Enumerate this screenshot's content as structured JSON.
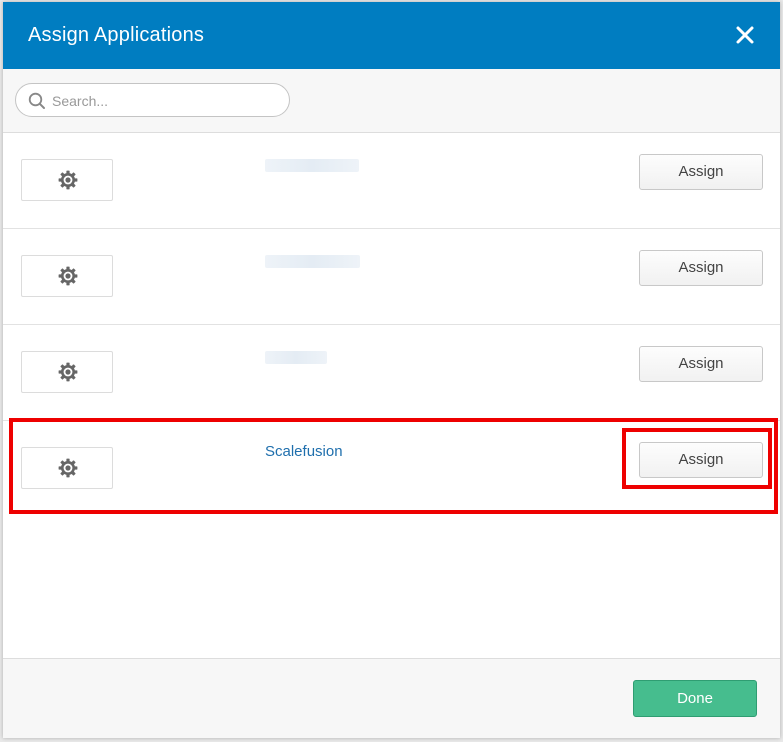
{
  "dialog": {
    "title": "Assign Applications",
    "close_icon": "close-icon"
  },
  "search": {
    "placeholder": "Search...",
    "value": "",
    "icon": "search-icon"
  },
  "apps": [
    {
      "name": "",
      "name_redacted": true,
      "logo_icon": "gear-icon",
      "assign_label": "Assign"
    },
    {
      "name": "",
      "name_redacted": true,
      "logo_icon": "gear-icon",
      "assign_label": "Assign"
    },
    {
      "name": "",
      "name_redacted": true,
      "logo_icon": "gear-icon",
      "assign_label": "Assign"
    },
    {
      "name": "Scalefusion",
      "name_redacted": false,
      "logo_icon": "gear-icon",
      "assign_label": "Assign"
    }
  ],
  "footer": {
    "done_label": "Done"
  },
  "colors": {
    "header_bg": "#007dc1",
    "link_text": "#1f6fad",
    "done_bg": "#46bd8e",
    "highlight": "#ee0000"
  }
}
